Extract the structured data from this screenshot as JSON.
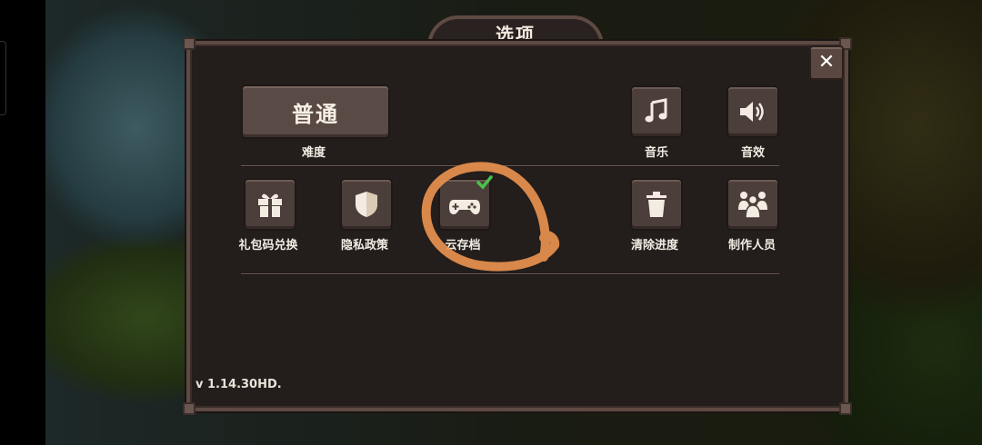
{
  "dialog": {
    "title": "选项",
    "close_label": "✕",
    "difficulty": {
      "button_label": "普通",
      "caption": "难度"
    },
    "music_label": "音乐",
    "sfx_label": "音效",
    "gift_code_label": "礼包码兑换",
    "privacy_label": "隐私政策",
    "cloud_save_label": "云存档",
    "clear_progress_label": "清除进度",
    "credits_label": "制作人员",
    "version": "v 1.14.30HD."
  },
  "icons": {
    "music": "music-note-icon",
    "sfx": "speaker-icon",
    "gift": "gift-icon",
    "privacy": "shield-icon",
    "cloud_save": "gamepad-icon",
    "clear": "trash-icon",
    "credits": "people-icon"
  },
  "colors": {
    "panel": "#231d1b",
    "frame": "#5e4a43",
    "button": "#4c3f3b",
    "annotation": "#e8914e",
    "checkmark": "#49c24a"
  }
}
